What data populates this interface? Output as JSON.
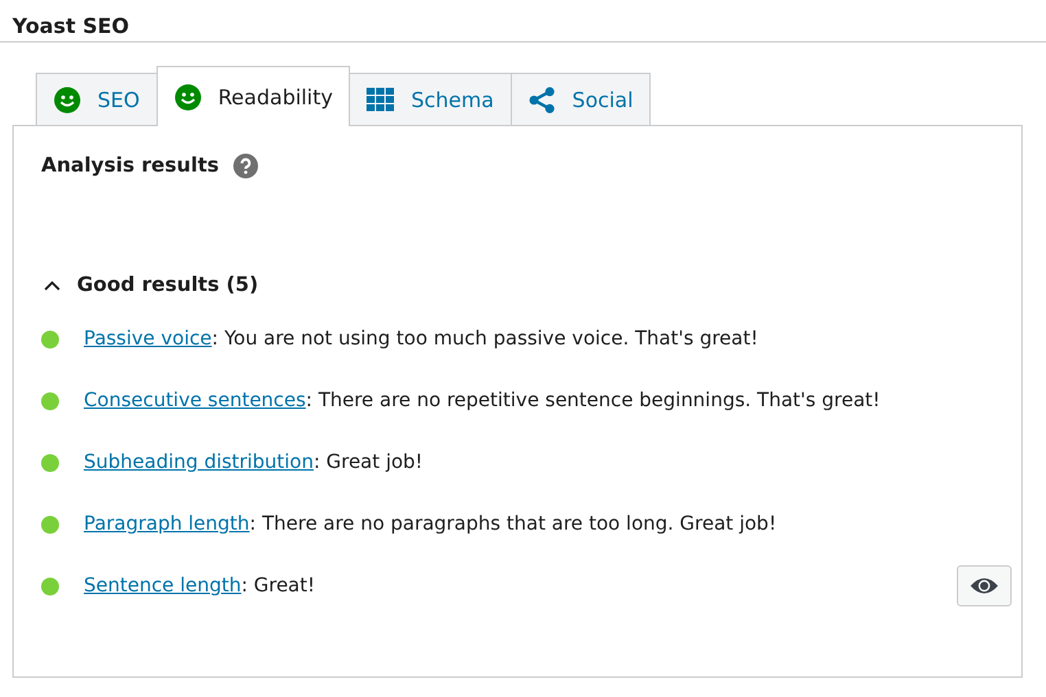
{
  "panel_title": "Yoast SEO",
  "tabs": [
    {
      "label": "SEO",
      "kind": "score",
      "selected": false
    },
    {
      "label": "Readability",
      "kind": "score",
      "selected": true
    },
    {
      "label": "Schema",
      "kind": "schema",
      "selected": false
    },
    {
      "label": "Social",
      "kind": "social",
      "selected": false
    }
  ],
  "analysis": {
    "heading": "Analysis results",
    "group": {
      "title": "Good results (5)",
      "expanded": true,
      "results": [
        {
          "link": "Passive voice",
          "text": ": You are not using too much passive voice. That's great!",
          "color": "#7ad03a"
        },
        {
          "link": "Consecutive sentences",
          "text": ": There are no repetitive sentence beginnings. That's great!",
          "color": "#7ad03a"
        },
        {
          "link": "Subheading distribution",
          "text": ": Great job!",
          "color": "#7ad03a"
        },
        {
          "link": "Paragraph length",
          "text": ": There are no paragraphs that are too long. Great job!",
          "color": "#7ad03a"
        },
        {
          "link": "Sentence length",
          "text": ": Great!",
          "color": "#7ad03a",
          "highlight_button": true
        }
      ]
    }
  }
}
